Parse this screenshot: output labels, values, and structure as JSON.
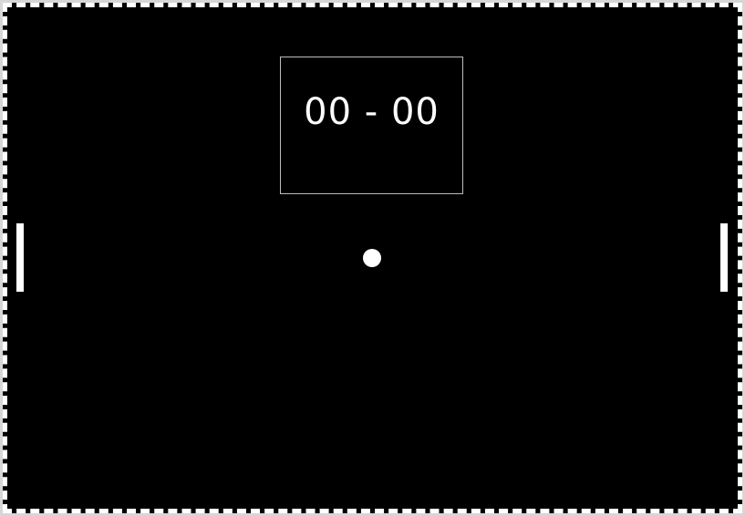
{
  "game": {
    "score": {
      "left": "00",
      "separator": "-",
      "right": "00"
    },
    "colors": {
      "background": "#000000",
      "foreground": "#ffffff",
      "score_border": "#bdbdbd",
      "page_border": "#d6d6d6"
    }
  }
}
